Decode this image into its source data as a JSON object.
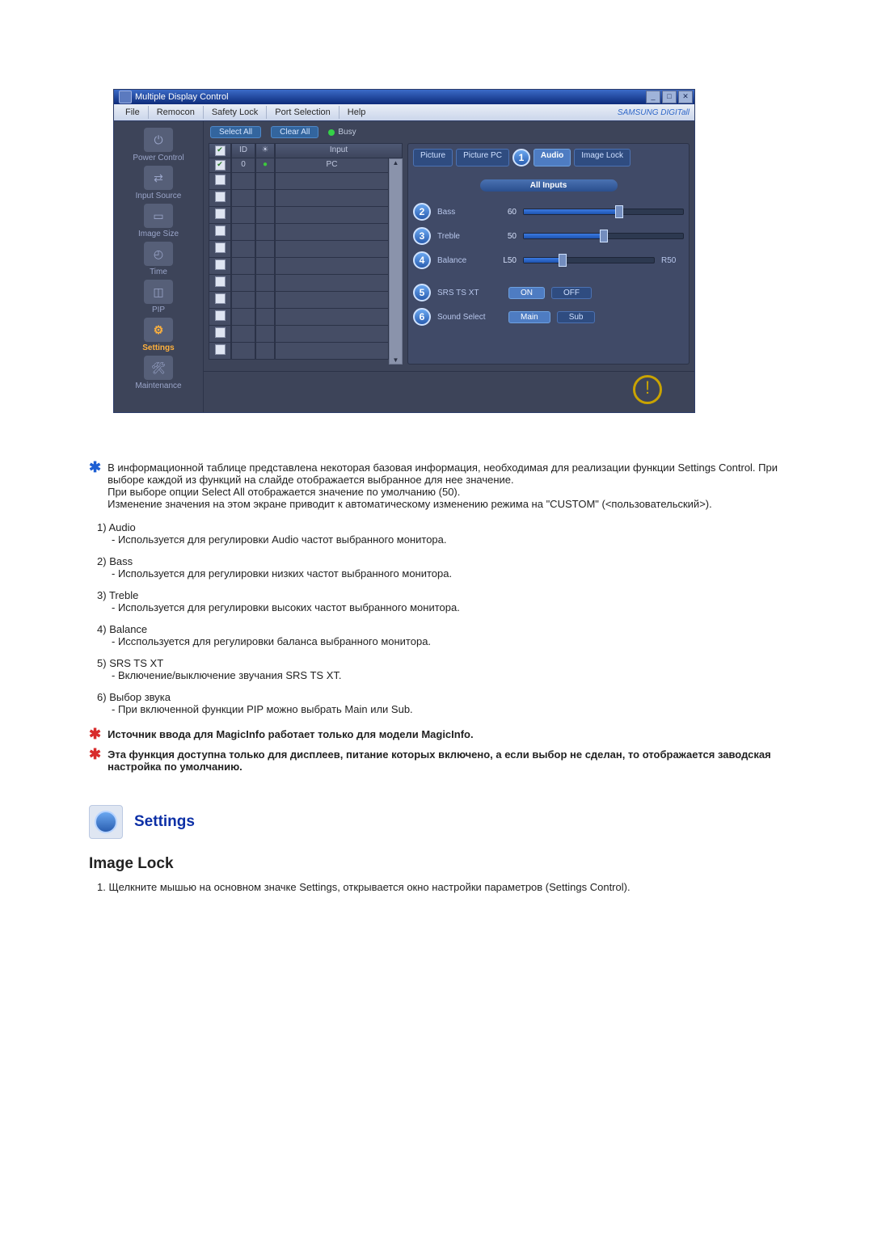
{
  "app": {
    "title": "Multiple Display Control",
    "brand": "SAMSUNG DIGITall",
    "menubar": [
      "File",
      "Remocon",
      "Safety Lock",
      "Port Selection",
      "Help"
    ]
  },
  "sidebar": [
    {
      "label": "Power Control"
    },
    {
      "label": "Input Source"
    },
    {
      "label": "Image Size"
    },
    {
      "label": "Time"
    },
    {
      "label": "PIP"
    },
    {
      "label": "Settings",
      "active": true
    },
    {
      "label": "Maintenance"
    }
  ],
  "topbar": {
    "select_all": "Select All",
    "clear_all": "Clear All",
    "busy": "Busy"
  },
  "table": {
    "head": {
      "check": "✓",
      "id": "ID",
      "st": "",
      "input": "Input"
    },
    "rows": [
      {
        "id": "0",
        "input": "PC",
        "checked": true,
        "hasStatus": true
      }
    ],
    "blank_rows": 11
  },
  "panel": {
    "tabs": [
      "Picture",
      "Picture PC",
      "Audio",
      "Image Lock"
    ],
    "active_tab": 2,
    "tab_callout": "1",
    "all_inputs": "All Inputs",
    "sliders": [
      {
        "num": "2",
        "label": "Bass",
        "val": "60",
        "pct": 60,
        "right": ""
      },
      {
        "num": "3",
        "label": "Treble",
        "val": "50",
        "pct": 50,
        "right": ""
      },
      {
        "num": "4",
        "label": "Balance",
        "val": "L50",
        "pct": 30,
        "right": "R50"
      }
    ],
    "toggles": [
      {
        "num": "5",
        "label": "SRS TS XT",
        "btns": [
          "ON",
          "OFF"
        ],
        "sel": 0
      },
      {
        "num": "6",
        "label": "Sound Select",
        "btns": [
          "Main",
          "Sub"
        ],
        "sel": 0
      }
    ]
  },
  "doc": {
    "lead1": "В информационной таблице представлена некоторая базовая информация, необходимая для реализации функции Settings Control. При выборе каждой из функций на слайде отображается выбранное для нее значение.",
    "lead2": "При выборе опции Select All отображается значение по умолчанию (50).",
    "lead3": "Изменение значения на этом экране приводит к автоматическому изменению режима на \"CUSTOM\" (<пользовательский>).",
    "items": [
      {
        "n": "1)",
        "t": "Audio",
        "d": "- Используется для регулировки Audio частот выбранного монитора."
      },
      {
        "n": "2)",
        "t": "Bass",
        "d": "- Используется для регулировки низких частот выбранного монитора."
      },
      {
        "n": "3)",
        "t": "Treble",
        "d": "- Используется для регулировки высоких частот выбранного монитора."
      },
      {
        "n": "4)",
        "t": "Balance",
        "d": "- Исспользуется для регулировки баланса выбранного монитора."
      },
      {
        "n": "5)",
        "t": "SRS TS XT",
        "d": "- Включение/выключение звучания SRS TS XT."
      },
      {
        "n": "6)",
        "t": "Выбор звука",
        "d": "- При включенной функции PIP можно выбрать Main или Sub."
      }
    ],
    "note1": "Источник ввода для MagicInfo работает только для модели MagicInfo.",
    "note2": "Эта функция доступна только для дисплеев, питание которых включено, а если выбор не сделан, то отображается заводская настройка по умолчанию.",
    "section_title": "Settings",
    "h2": "Image Lock",
    "step1_num": "1.",
    "step1": "Щелкните мышью на основном значке Settings, открывается окно настройки параметров (Settings Control)."
  }
}
